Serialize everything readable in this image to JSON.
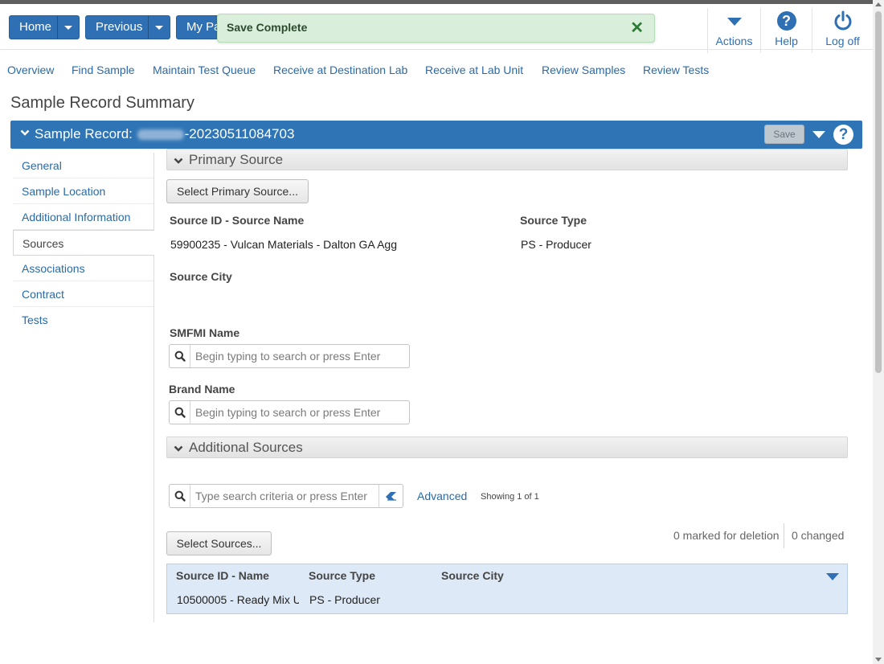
{
  "topbar": {
    "home_label": "Home",
    "previous_label": "Previous",
    "mypages_label": "My Pa",
    "toast_text": "Save Complete",
    "toast_close": "✕",
    "actions_label": "Actions",
    "help_label": "Help",
    "help_glyph": "?",
    "logoff_label": "Log off"
  },
  "subnav": [
    "Overview",
    "Find Sample",
    "Maintain Test Queue",
    "Receive at Destination Lab",
    "Receive at Lab Unit",
    "Review Samples",
    "Review Tests"
  ],
  "page_title": "Sample Record Summary",
  "record_bar": {
    "label": "Sample Record",
    "separator": ":",
    "id_suffix": "-20230511084703",
    "save_label": "Save",
    "help_glyph": "?"
  },
  "sidebar": {
    "items": [
      "General",
      "Sample Location",
      "Additional Information",
      "Sources",
      "Associations",
      "Contract",
      "Tests"
    ],
    "active": "Sources"
  },
  "primary_source": {
    "section_title": "Primary Source",
    "select_button": "Select Primary Source...",
    "source_id_label": "Source ID - Source Name",
    "source_id_value": "59900235 - Vulcan Materials - Dalton GA Agg",
    "source_type_label": "Source Type",
    "source_type_value": "PS - Producer",
    "source_city_label": "Source City",
    "smfmi_label": "SMFMI Name",
    "smfmi_placeholder": "Begin typing to search or press Enter",
    "brand_label": "Brand Name",
    "brand_placeholder": "Begin typing to search or press Enter"
  },
  "additional_sources": {
    "section_title": "Additional Sources",
    "search_placeholder": "Type search criteria or press Enter",
    "advanced_label": "Advanced",
    "showing_text": "Showing 1 of 1",
    "select_button": "Select Sources...",
    "marked_for_deletion": "0 marked for deletion",
    "changed": "0 changed",
    "columns": [
      "Source ID - Name",
      "Source Type",
      "Source City"
    ],
    "rows": [
      {
        "id_name": "10500005 - Ready Mix U",
        "type": "PS - Producer",
        "city": ""
      }
    ]
  },
  "colors": {
    "primary": "#2f75b5",
    "toast_bg": "#d9eedb",
    "link": "#2a6aa8"
  }
}
